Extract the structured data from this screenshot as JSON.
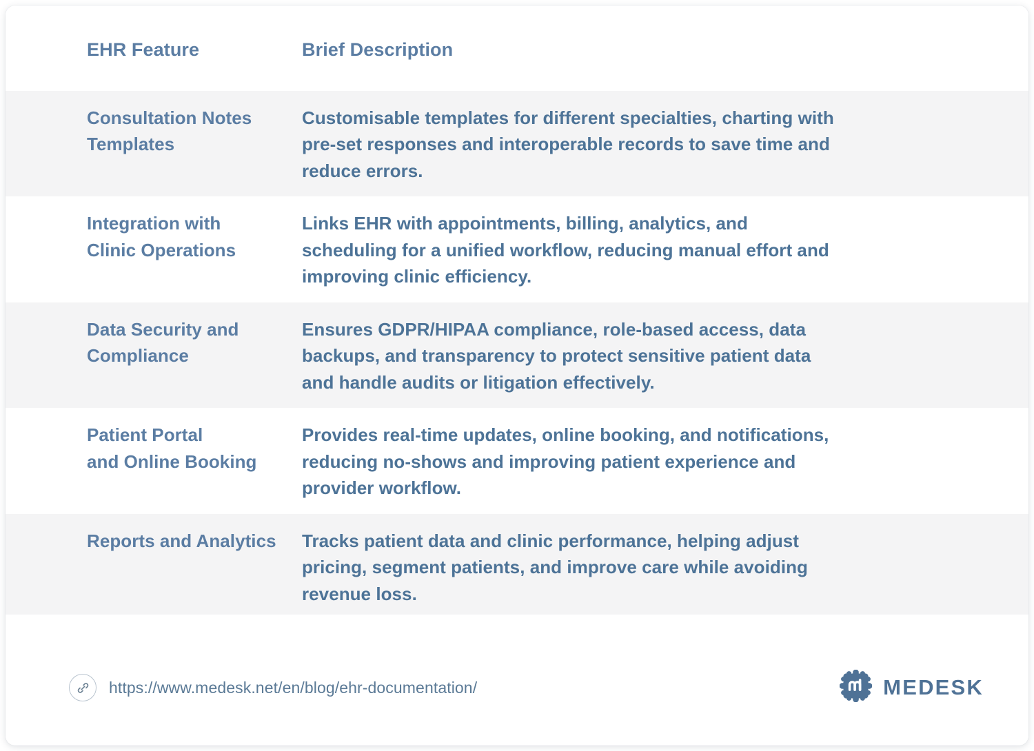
{
  "table": {
    "columns": [
      {
        "key": "feature",
        "label": "EHR Feature"
      },
      {
        "key": "description",
        "label": "Brief Description"
      }
    ],
    "rows": [
      {
        "feature": "Consultation Notes Templates",
        "feature_line1": "Consultation Notes",
        "feature_line2": "Templates",
        "description": "Customisable templates for different specialties, charting with pre-set responses and interoperable records to save time and reduce errors.",
        "description_line1": "Customisable templates for different specialties, charting with",
        "description_line2": "pre-set responses and interoperable records to save time and",
        "description_line3": "reduce errors.",
        "shaded": true
      },
      {
        "feature": "Integration with Clinic Operations",
        "feature_line1": "Integration with",
        "feature_line2": "Clinic Operations",
        "description": "Links EHR with appointments, billing, analytics, and scheduling for a unified workflow, reducing manual effort and improving clinic efficiency.",
        "description_line1": "Links EHR with appointments, billing, analytics, and",
        "description_line2": "scheduling for a unified workflow, reducing manual effort and",
        "description_line3": "improving clinic efficiency.",
        "shaded": false
      },
      {
        "feature": "Data Security and Compliance",
        "feature_line1": "Data Security and",
        "feature_line2": "Compliance",
        "description": "Ensures GDPR/HIPAA compliance, role-based access, data backups, and transparency to protect sensitive patient data and handle audits or litigation effectively.",
        "description_line1": "Ensures GDPR/HIPAA compliance, role-based access, data",
        "description_line2": "backups, and transparency to protect sensitive patient data",
        "description_line3": "and handle audits or litigation effectively.",
        "shaded": true
      },
      {
        "feature": "Patient Portal and Online Booking",
        "feature_line1": "Patient Portal",
        "feature_line2": "and Online Booking",
        "description": "Provides real-time updates, online booking, and notifications, reducing no-shows and improving patient experience and provider workflow.",
        "description_line1": "Provides real-time updates, online booking, and notifications,",
        "description_line2": "reducing no-shows and improving patient experience and",
        "description_line3": "provider workflow.",
        "shaded": false
      },
      {
        "feature": "Reports and Analytics",
        "feature_line1": "Reports and Analytics",
        "feature_line2": "",
        "description": "Tracks patient data and clinic performance, helping adjust pricing, segment patients, and improve care while avoiding revenue loss.",
        "description_line1": "Tracks patient data and clinic performance, helping adjust",
        "description_line2": "pricing, segment patients, and improve care while avoiding",
        "description_line3": "revenue loss.",
        "shaded": true
      }
    ]
  },
  "footer": {
    "link_icon": "link-chain-icon",
    "source_url": "https://www.medesk.net/en/blog/ehr-documentation/",
    "brand_name": "MEDESK",
    "brand_mark": "medesk-scalloped-badge-icon"
  },
  "colors": {
    "heading_blue": "#5b7da3",
    "body_blue": "#4d7397",
    "row_shade": "#f4f4f5",
    "card_bg": "#ffffff",
    "brand_blue": "#4f7296",
    "icon_outline": "#b9c4cf"
  }
}
